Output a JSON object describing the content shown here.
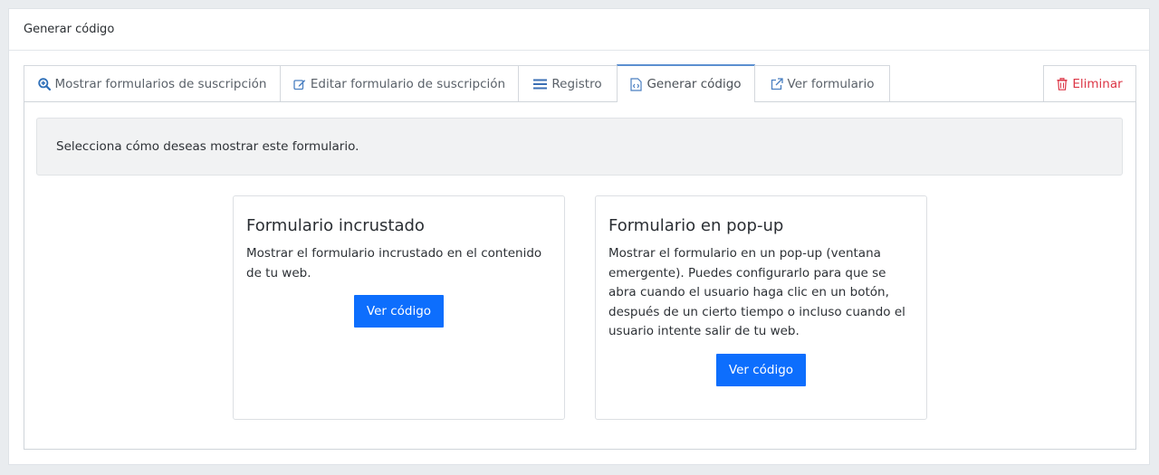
{
  "header": {
    "title": "Generar código"
  },
  "tabs": [
    {
      "label": "Mostrar formularios de suscripción",
      "icon": "zoom-in-icon"
    },
    {
      "label": "Editar formulario de suscripción",
      "icon": "edit-icon"
    },
    {
      "label": "Registro",
      "icon": "list-icon"
    },
    {
      "label": "Generar código",
      "icon": "code-file-icon",
      "active": true
    },
    {
      "label": "Ver formulario",
      "icon": "external-link-icon"
    },
    {
      "label": "Eliminar",
      "icon": "trash-icon"
    }
  ],
  "info": {
    "text": "Selecciona cómo deseas mostrar este formulario."
  },
  "cards": [
    {
      "title": "Formulario incrustado",
      "description": "Mostrar el formulario incrustado en el contenido de tu web.",
      "button": "Ver código"
    },
    {
      "title": "Formulario en pop-up",
      "description": "Mostrar el formulario en un pop-up (ventana emergente). Puedes configurarlo para que se abra cuando el usuario haga clic en un botón, después de un cierto tiempo o incluso cuando el usuario intente salir de tu web.",
      "button": "Ver código"
    }
  ],
  "colors": {
    "primary": "#0d6efd",
    "icon_blue": "#4a7fc1",
    "danger": "#dc3545"
  }
}
